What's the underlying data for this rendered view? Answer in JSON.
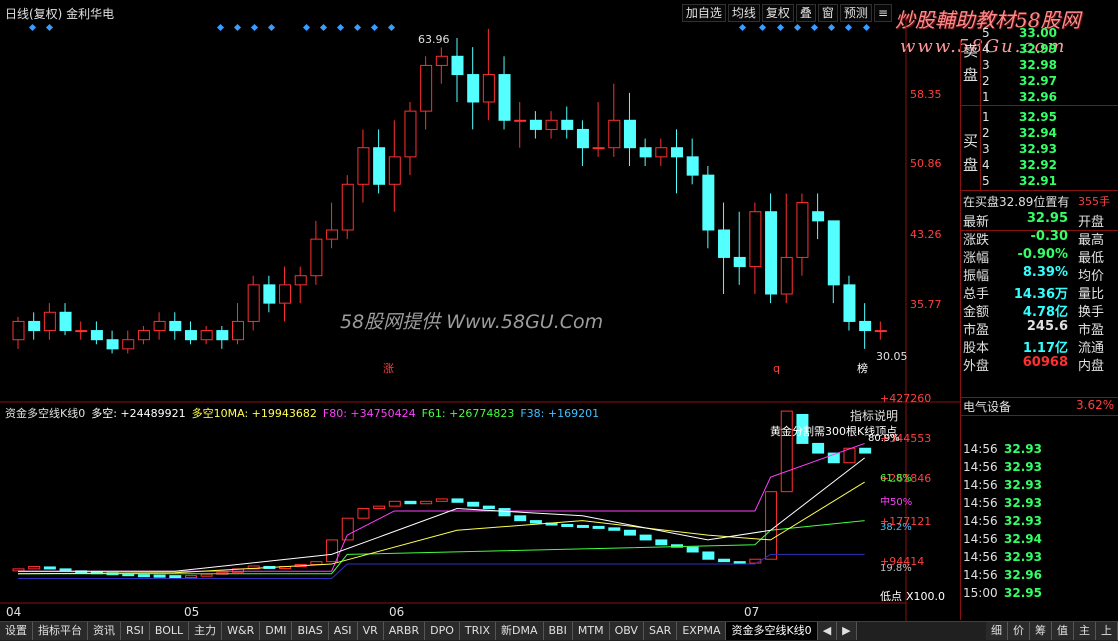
{
  "app": {
    "title": "日线(复权)  金利华电",
    "watermark_text": "58股网提供  Www.58GU.Com",
    "brand_text": "炒股輔助教材58股网",
    "brand_url": "www.58Gu.com"
  },
  "toolbar": {
    "buttons": [
      "加自选",
      "均线",
      "复权",
      "叠",
      "窗",
      "预测"
    ],
    "menu_icon": "menu-lines-icon"
  },
  "main_chart": {
    "price_axis": [
      "58.35",
      "50.86",
      "43.26",
      "35.77"
    ],
    "high_label": "63.96",
    "low_label": "30.05",
    "markers": [
      "涨",
      "q",
      "榜"
    ],
    "colors": {
      "up": "#ff3030",
      "down": "#54ffff",
      "axis": "#8a1010"
    }
  },
  "indicator": {
    "name": "资金多空线K线0",
    "items": [
      {
        "label": "多空: +24489921",
        "color": "#ffffff"
      },
      {
        "label": "多空10MA: +19943682",
        "color": "#ffff50"
      },
      {
        "label": "F80: +34750424",
        "color": "#ff40ff"
      },
      {
        "label": "F61: +26774823",
        "color": "#40ff40"
      },
      {
        "label": "F38: +169201",
        "color": "#40c0ff"
      }
    ],
    "explain": "指标说明",
    "golden_note": "黄金分割需300根K线顶点",
    "axis": [
      "+427260",
      "+344553",
      "+261846",
      "+177121",
      "+94414"
    ],
    "ratio_labels": [
      "80.9%",
      "61.8%",
      "中50%",
      "38.2%",
      "19.8%"
    ],
    "low_text": "低点",
    "x100": "X100.0"
  },
  "x_axis": [
    "04",
    "05",
    "06",
    "07"
  ],
  "order_book": {
    "sell": [
      {
        "idx": "5",
        "price": "33.00"
      },
      {
        "idx": "4",
        "price": "32.99"
      },
      {
        "idx": "3",
        "price": "32.98"
      },
      {
        "idx": "2",
        "price": "32.97"
      },
      {
        "idx": "1",
        "price": "32.96"
      }
    ],
    "buy": [
      {
        "idx": "1",
        "price": "32.95"
      },
      {
        "idx": "2",
        "price": "32.94"
      },
      {
        "idx": "3",
        "price": "32.93"
      },
      {
        "idx": "4",
        "price": "32.92"
      },
      {
        "idx": "5",
        "price": "32.91"
      }
    ],
    "sell_label": [
      "卖",
      "盘"
    ],
    "buy_label": [
      "买",
      "盘"
    ],
    "note": "在买盘32.89位置有",
    "note_qty": "355手"
  },
  "quote": [
    {
      "l": "最新",
      "v": "32.95",
      "r": "开盘",
      "c": "#33ff66"
    },
    {
      "l": "涨跌",
      "v": "-0.30",
      "r": "最高",
      "c": "#33ff66"
    },
    {
      "l": "涨幅",
      "v": "-0.90%",
      "r": "最低",
      "c": "#33ff66"
    },
    {
      "l": "振幅",
      "v": "8.39%",
      "r": "均价",
      "c": "#33ffff"
    },
    {
      "l": "总手",
      "v": "14.36万",
      "r": "量比",
      "c": "#33ffff"
    },
    {
      "l": "金额",
      "v": "4.78亿",
      "r": "换手",
      "c": "#33ffff"
    },
    {
      "l": "市盈",
      "v": "245.6",
      "r": "市盈",
      "c": "#e0e0e0"
    },
    {
      "l": "股本",
      "v": "1.17亿",
      "r": "流通",
      "c": "#33ffff"
    },
    {
      "l": "外盘",
      "v": "60968",
      "r": "内盘",
      "c": "#ff3030"
    }
  ],
  "sector": {
    "name": "电气设备",
    "pct": "3.62%"
  },
  "ticks": [
    {
      "t": "14:56",
      "p": "32.93"
    },
    {
      "t": "14:56",
      "p": "32.93"
    },
    {
      "t": "14:56",
      "p": "32.93"
    },
    {
      "t": "14:56",
      "p": "32.93"
    },
    {
      "t": "14:56",
      "p": "32.93"
    },
    {
      "t": "14:56",
      "p": "32.94"
    },
    {
      "t": "14:56",
      "p": "32.93"
    },
    {
      "t": "14:56",
      "p": "32.96"
    },
    {
      "t": "15:00",
      "p": "32.95"
    }
  ],
  "bottom_tabs": [
    "设置",
    "指标平台",
    "资讯",
    "RSI",
    "BOLL",
    "主力",
    "W&R",
    "DMI",
    "BIAS",
    "ASI",
    "VR",
    "ARBR",
    "DPO",
    "TRIX",
    "新DMA",
    "BBI",
    "MTM",
    "OBV",
    "SAR",
    "EXPMA",
    "资金多空线K线0"
  ],
  "bottom_right_tabs": [
    "细",
    "价",
    "筹",
    "值",
    "主",
    "上"
  ],
  "chart_data": {
    "type": "candlestick",
    "price_range": [
      30.05,
      63.96
    ],
    "candles": [
      [
        32,
        34,
        31,
        34.5
      ],
      [
        34,
        33,
        32,
        35
      ],
      [
        33,
        35,
        32,
        36
      ],
      [
        35,
        33,
        32.5,
        36
      ],
      [
        33,
        33,
        32,
        34
      ],
      [
        33,
        32,
        31.5,
        34
      ],
      [
        32,
        31,
        30.5,
        33
      ],
      [
        31,
        32,
        30.5,
        33
      ],
      [
        32,
        33,
        31.5,
        33.5
      ],
      [
        33,
        34,
        32,
        35
      ],
      [
        34,
        33,
        32,
        35
      ],
      [
        33,
        32,
        31.5,
        34
      ],
      [
        32,
        33,
        31.5,
        33.5
      ],
      [
        33,
        32,
        31,
        33.5
      ],
      [
        32,
        34,
        31.5,
        36
      ],
      [
        34,
        38,
        33,
        39
      ],
      [
        38,
        36,
        35,
        39
      ],
      [
        36,
        38,
        34,
        40
      ],
      [
        38,
        39,
        36,
        40
      ],
      [
        39,
        43,
        38,
        45
      ],
      [
        43,
        44,
        42,
        47
      ],
      [
        44,
        49,
        43,
        50
      ],
      [
        49,
        53,
        47,
        55
      ],
      [
        53,
        49,
        48,
        55
      ],
      [
        49,
        52,
        46,
        56
      ],
      [
        52,
        57,
        50,
        58
      ],
      [
        57,
        62,
        55,
        63
      ],
      [
        62,
        63,
        60,
        63.96
      ],
      [
        63,
        61,
        58,
        65
      ],
      [
        61,
        58,
        55,
        64
      ],
      [
        58,
        61,
        56,
        66
      ],
      [
        61,
        56,
        55,
        63
      ],
      [
        56,
        56,
        53,
        58
      ],
      [
        56,
        55,
        54,
        57
      ],
      [
        55,
        56,
        54,
        57
      ],
      [
        56,
        55,
        54,
        57.5
      ],
      [
        55,
        53,
        51,
        56
      ],
      [
        53,
        53,
        52,
        58
      ],
      [
        53,
        56,
        52,
        60
      ],
      [
        56,
        53,
        51,
        59
      ],
      [
        53,
        52,
        51,
        54
      ],
      [
        52,
        53,
        51,
        54
      ],
      [
        53,
        52,
        48,
        55
      ],
      [
        52,
        50,
        49,
        54
      ],
      [
        50,
        44,
        42,
        51
      ],
      [
        44,
        41,
        37,
        47
      ],
      [
        41,
        40,
        38,
        46
      ],
      [
        40,
        46,
        37,
        47
      ],
      [
        46,
        37,
        36,
        48
      ],
      [
        37,
        41,
        36,
        48
      ],
      [
        41,
        47,
        39,
        48
      ],
      [
        46,
        45,
        43,
        48
      ],
      [
        45,
        38,
        36,
        45
      ],
      [
        38,
        34,
        33,
        39
      ],
      [
        34,
        33,
        31,
        36
      ],
      [
        33,
        33,
        32,
        34
      ]
    ],
    "indicator_candles": [
      [
        98000.0,
        100000.0
      ],
      [
        100000.0,
        105000.0
      ],
      [
        104000.0,
        100000.0
      ],
      [
        100000.0,
        96000.0
      ],
      [
        96000.0,
        94000.0
      ],
      [
        94000.0,
        92000.0
      ],
      [
        92000.0,
        90000.0
      ],
      [
        90000.0,
        88000.0
      ],
      [
        88000.0,
        87000.0
      ],
      [
        87000.0,
        86000.0
      ],
      [
        86000.0,
        85000.0
      ],
      [
        85000.0,
        86000.0
      ],
      [
        86000.0,
        89000.0
      ],
      [
        89000.0,
        93000.0
      ],
      [
        93000.0,
        100000.0
      ],
      [
        100000.0,
        106000.0
      ],
      [
        105000.0,
        102000.0
      ],
      [
        102000.0,
        105000.0
      ],
      [
        105000.0,
        109000.0
      ],
      [
        109000.0,
        115000.0
      ],
      [
        115000.0,
        160000.0
      ],
      [
        160000.0,
        205000.0
      ],
      [
        205000.0,
        225000.0
      ],
      [
        225000.0,
        230000.0
      ],
      [
        230000.0,
        240000.0
      ],
      [
        240000.0,
        235000.0
      ],
      [
        235000.0,
        240000.0
      ],
      [
        240000.0,
        245000.0
      ],
      [
        245000.0,
        238000.0
      ],
      [
        238000.0,
        230000.0
      ],
      [
        230000.0,
        225000.0
      ],
      [
        225000.0,
        210000.0
      ],
      [
        210000.0,
        200000.0
      ],
      [
        200000.0,
        195000.0
      ],
      [
        195000.0,
        192000.0
      ],
      [
        192000.0,
        190000.0
      ],
      [
        190000.0,
        188000.0
      ],
      [
        188000.0,
        185000.0
      ],
      [
        185000.0,
        180000.0
      ],
      [
        180000.0,
        170000.0
      ],
      [
        170000.0,
        160000.0
      ],
      [
        160000.0,
        150000.0
      ],
      [
        150000.0,
        145000.0
      ],
      [
        145000.0,
        135000.0
      ],
      [
        135000.0,
        120000.0
      ],
      [
        120000.0,
        115000.0
      ],
      [
        115000.0,
        112000.0
      ],
      [
        112000.0,
        120000.0
      ],
      [
        120000.0,
        260000.0
      ],
      [
        260000.0,
        427000.0
      ],
      [
        420000.0,
        360000.0
      ],
      [
        360000.0,
        340000.0
      ],
      [
        340000.0,
        320000.0
      ],
      [
        320000.0,
        350000.0
      ],
      [
        350000.0,
        340000.0
      ]
    ]
  }
}
